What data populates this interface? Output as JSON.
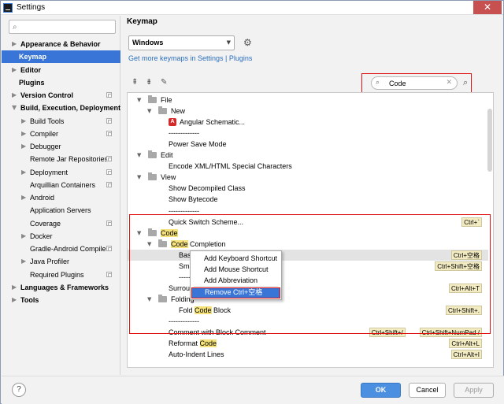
{
  "window": {
    "title": "Settings",
    "close_glyph": "✕"
  },
  "sidebar": {
    "search_placeholder": "",
    "items": [
      {
        "label": "Appearance & Behavior",
        "arrow": "▶",
        "bold": true
      },
      {
        "label": "Keymap",
        "arrow": "",
        "bold": true,
        "selected": true
      },
      {
        "label": "Editor",
        "arrow": "▶",
        "bold": true
      },
      {
        "label": "Plugins",
        "arrow": "",
        "bold": true
      },
      {
        "label": "Version Control",
        "arrow": "▶",
        "bold": true,
        "copy_icon": true
      },
      {
        "label": "Build, Execution, Deployment",
        "arrow": "▼",
        "bold": true
      },
      {
        "label": "Build Tools",
        "arrow": "▶",
        "copy_icon": true
      },
      {
        "label": "Compiler",
        "arrow": "▶",
        "copy_icon": true
      },
      {
        "label": "Debugger",
        "arrow": "▶"
      },
      {
        "label": "Remote Jar Repositories",
        "arrow": "",
        "copy_icon": true
      },
      {
        "label": "Deployment",
        "arrow": "▶",
        "copy_icon": true
      },
      {
        "label": "Arquillian Containers",
        "arrow": "",
        "copy_icon": true
      },
      {
        "label": "Android",
        "arrow": "▶"
      },
      {
        "label": "Application Servers",
        "arrow": ""
      },
      {
        "label": "Coverage",
        "arrow": "",
        "copy_icon": true
      },
      {
        "label": "Docker",
        "arrow": "▶"
      },
      {
        "label": "Gradle-Android Compiler",
        "arrow": "",
        "copy_icon": true
      },
      {
        "label": "Java Profiler",
        "arrow": "▶"
      },
      {
        "label": "Required Plugins",
        "arrow": "",
        "copy_icon": true
      },
      {
        "label": "Languages & Frameworks",
        "arrow": "▶",
        "bold": true
      },
      {
        "label": "Tools",
        "arrow": "▶",
        "bold": true
      }
    ]
  },
  "main": {
    "title": "Keymap",
    "keymap_value": "Windows",
    "more_link": "Get more keymaps in Settings | Plugins",
    "search_value": "Code"
  },
  "tree": [
    {
      "arrow": "▼",
      "folder": true,
      "parts": [
        [
          "File",
          false
        ]
      ]
    },
    {
      "arrow": "▼",
      "folder": true,
      "parts": [
        [
          "New",
          false
        ]
      ]
    },
    {
      "angular": true,
      "parts": [
        [
          "Angular Schematic...",
          false
        ]
      ]
    },
    {
      "parts": [
        [
          "-------------",
          false
        ]
      ]
    },
    {
      "parts": [
        [
          "Power Save Mode",
          false
        ]
      ]
    },
    {
      "arrow": "▼",
      "folder": true,
      "parts": [
        [
          "Edit",
          false
        ]
      ]
    },
    {
      "parts": [
        [
          "Encode XML/HTML Special Characters",
          false
        ]
      ]
    },
    {
      "arrow": "▼",
      "folder": true,
      "parts": [
        [
          "View",
          false
        ]
      ]
    },
    {
      "parts": [
        [
          "Show Decompiled Class",
          false
        ]
      ]
    },
    {
      "parts": [
        [
          "Show Bytecode",
          false
        ]
      ]
    },
    {
      "parts": [
        [
          "-------------",
          false
        ]
      ]
    },
    {
      "parts": [
        [
          "Quick Switch Scheme...",
          false
        ]
      ],
      "shortcuts": [
        "Ctrl+`"
      ]
    },
    {
      "arrow": "▼",
      "folder": true,
      "parts": [
        [
          "Code",
          true
        ]
      ]
    },
    {
      "arrow": "▼",
      "folder": true,
      "parts": [
        [
          "Code",
          true
        ],
        [
          " Completion",
          false
        ]
      ]
    },
    {
      "parts": [
        [
          "Basic",
          false
        ]
      ],
      "shortcuts": [
        "Ctrl+空格"
      ],
      "highlight": true
    },
    {
      "parts": [
        [
          "Smart Type",
          false
        ]
      ],
      "shortcuts": [
        "Ctrl+Shift+空格"
      ]
    },
    {
      "parts": [
        [
          "-------------",
          false
        ]
      ]
    },
    {
      "parts": [
        [
          "Surround With...",
          false
        ]
      ],
      "shortcuts": [
        "Ctrl+Alt+T"
      ]
    },
    {
      "arrow": "▼",
      "folder": true,
      "parts": [
        [
          "Folding",
          false
        ]
      ]
    },
    {
      "parts": [
        [
          "Fold ",
          false
        ],
        [
          "Code",
          true
        ],
        [
          " Block",
          false
        ]
      ],
      "shortcuts": [
        "Ctrl+Shift+."
      ]
    },
    {
      "parts": [
        [
          "-------------",
          false
        ]
      ]
    },
    {
      "parts": [
        [
          "Comment with Block Comment",
          false
        ]
      ],
      "shortcuts": [
        "Ctrl+Shift+/",
        "Ctrl+Shift+NumPad /"
      ]
    },
    {
      "parts": [
        [
          "Reformat ",
          false
        ],
        [
          "Code",
          true
        ]
      ],
      "shortcuts": [
        "Ctrl+Alt+L"
      ]
    },
    {
      "parts": [
        [
          "Auto-Indent Lines",
          false
        ]
      ],
      "shortcuts": [
        "Ctrl+Alt+I"
      ]
    }
  ],
  "context_menu": {
    "items": [
      "Add Keyboard Shortcut",
      "Add Mouse Shortcut",
      "Add Abbreviation",
      "Remove Ctrl+空格"
    ]
  },
  "footer": {
    "help": "?",
    "ok": "OK",
    "cancel": "Cancel",
    "apply": "Apply"
  },
  "icons": {
    "search": "⌕",
    "gear": "⚙",
    "expand_all": "⇞",
    "collapse_all": "⇟",
    "edit": "✎",
    "find_shortcut": "⌕"
  },
  "colors": {
    "accent": "#3875d7",
    "highlight_box": "#e01010",
    "match_highlight": "#f5e27a",
    "angular": "#d52a2a"
  }
}
